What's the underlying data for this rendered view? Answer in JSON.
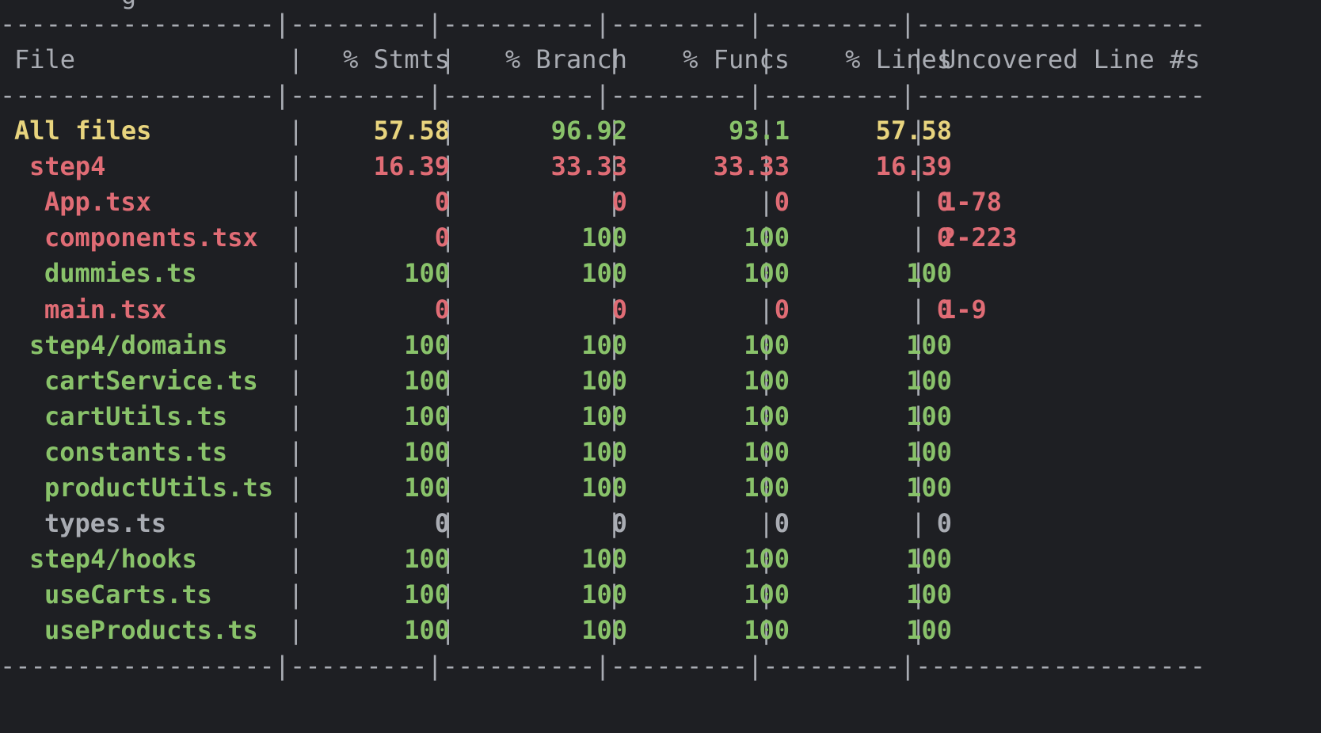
{
  "top_fragment": "  ──── g ",
  "separator": "------------------|---------|----------|---------|---------|-------------------",
  "header": {
    "file": "File",
    "stmts": "% Stmts",
    "branch": "% Branch",
    "funcs": "% Funcs",
    "lines": "% Lines",
    "uncovered": "Uncovered Line #s"
  },
  "colors": {
    "background": "#1e1f23",
    "text": "#a9acb3",
    "yellow": "#e8d47e",
    "red": "#e06c75",
    "green": "#89c26a"
  },
  "rows": [
    {
      "file": "All files",
      "indent": 0,
      "stmts": "57.58",
      "branch": "96.92",
      "funcs": "93.1",
      "lines": "57.58",
      "uncovered": "",
      "name_color": "yellow",
      "stmts_color": "yellow",
      "branch_color": "green",
      "funcs_color": "green",
      "lines_color": "yellow",
      "uncovered_color": "red"
    },
    {
      "file": "step4",
      "indent": 1,
      "stmts": "16.39",
      "branch": "33.33",
      "funcs": "33.33",
      "lines": "16.39",
      "uncovered": "",
      "name_color": "red",
      "stmts_color": "red",
      "branch_color": "red",
      "funcs_color": "red",
      "lines_color": "red",
      "uncovered_color": "red"
    },
    {
      "file": "App.tsx",
      "indent": 2,
      "stmts": "0",
      "branch": "0",
      "funcs": "0",
      "lines": "0",
      "uncovered": "1-78",
      "name_color": "red",
      "stmts_color": "red",
      "branch_color": "red",
      "funcs_color": "red",
      "lines_color": "red",
      "uncovered_color": "red"
    },
    {
      "file": "components.tsx",
      "indent": 2,
      "stmts": "0",
      "branch": "100",
      "funcs": "100",
      "lines": "0",
      "uncovered": "2-223",
      "name_color": "red",
      "stmts_color": "red",
      "branch_color": "green",
      "funcs_color": "green",
      "lines_color": "red",
      "uncovered_color": "red"
    },
    {
      "file": "dummies.ts",
      "indent": 2,
      "stmts": "100",
      "branch": "100",
      "funcs": "100",
      "lines": "100",
      "uncovered": "",
      "name_color": "green",
      "stmts_color": "green",
      "branch_color": "green",
      "funcs_color": "green",
      "lines_color": "green",
      "uncovered_color": "red"
    },
    {
      "file": "main.tsx",
      "indent": 2,
      "stmts": "0",
      "branch": "0",
      "funcs": "0",
      "lines": "0",
      "uncovered": "1-9",
      "name_color": "red",
      "stmts_color": "red",
      "branch_color": "red",
      "funcs_color": "red",
      "lines_color": "red",
      "uncovered_color": "red"
    },
    {
      "file": "step4/domains",
      "indent": 1,
      "stmts": "100",
      "branch": "100",
      "funcs": "100",
      "lines": "100",
      "uncovered": "",
      "name_color": "green",
      "stmts_color": "green",
      "branch_color": "green",
      "funcs_color": "green",
      "lines_color": "green",
      "uncovered_color": "red"
    },
    {
      "file": "cartService.ts",
      "indent": 2,
      "stmts": "100",
      "branch": "100",
      "funcs": "100",
      "lines": "100",
      "uncovered": "",
      "name_color": "green",
      "stmts_color": "green",
      "branch_color": "green",
      "funcs_color": "green",
      "lines_color": "green",
      "uncovered_color": "red"
    },
    {
      "file": "cartUtils.ts",
      "indent": 2,
      "stmts": "100",
      "branch": "100",
      "funcs": "100",
      "lines": "100",
      "uncovered": "",
      "name_color": "green",
      "stmts_color": "green",
      "branch_color": "green",
      "funcs_color": "green",
      "lines_color": "green",
      "uncovered_color": "red"
    },
    {
      "file": "constants.ts",
      "indent": 2,
      "stmts": "100",
      "branch": "100",
      "funcs": "100",
      "lines": "100",
      "uncovered": "",
      "name_color": "green",
      "stmts_color": "green",
      "branch_color": "green",
      "funcs_color": "green",
      "lines_color": "green",
      "uncovered_color": "red"
    },
    {
      "file": "productUtils.ts",
      "indent": 2,
      "stmts": "100",
      "branch": "100",
      "funcs": "100",
      "lines": "100",
      "uncovered": "",
      "name_color": "green",
      "stmts_color": "green",
      "branch_color": "green",
      "funcs_color": "green",
      "lines_color": "green",
      "uncovered_color": "red"
    },
    {
      "file": "types.ts",
      "indent": 2,
      "stmts": "0",
      "branch": "0",
      "funcs": "0",
      "lines": "0",
      "uncovered": "",
      "name_color": "text",
      "stmts_color": "text",
      "branch_color": "text",
      "funcs_color": "text",
      "lines_color": "text",
      "uncovered_color": "text"
    },
    {
      "file": "step4/hooks",
      "indent": 1,
      "stmts": "100",
      "branch": "100",
      "funcs": "100",
      "lines": "100",
      "uncovered": "",
      "name_color": "green",
      "stmts_color": "green",
      "branch_color": "green",
      "funcs_color": "green",
      "lines_color": "green",
      "uncovered_color": "red"
    },
    {
      "file": "useCarts.ts",
      "indent": 2,
      "stmts": "100",
      "branch": "100",
      "funcs": "100",
      "lines": "100",
      "uncovered": "",
      "name_color": "green",
      "stmts_color": "green",
      "branch_color": "green",
      "funcs_color": "green",
      "lines_color": "green",
      "uncovered_color": "red"
    },
    {
      "file": "useProducts.ts",
      "indent": 2,
      "stmts": "100",
      "branch": "100",
      "funcs": "100",
      "lines": "100",
      "uncovered": "",
      "name_color": "green",
      "stmts_color": "green",
      "branch_color": "green",
      "funcs_color": "green",
      "lines_color": "green",
      "uncovered_color": "red"
    }
  ]
}
